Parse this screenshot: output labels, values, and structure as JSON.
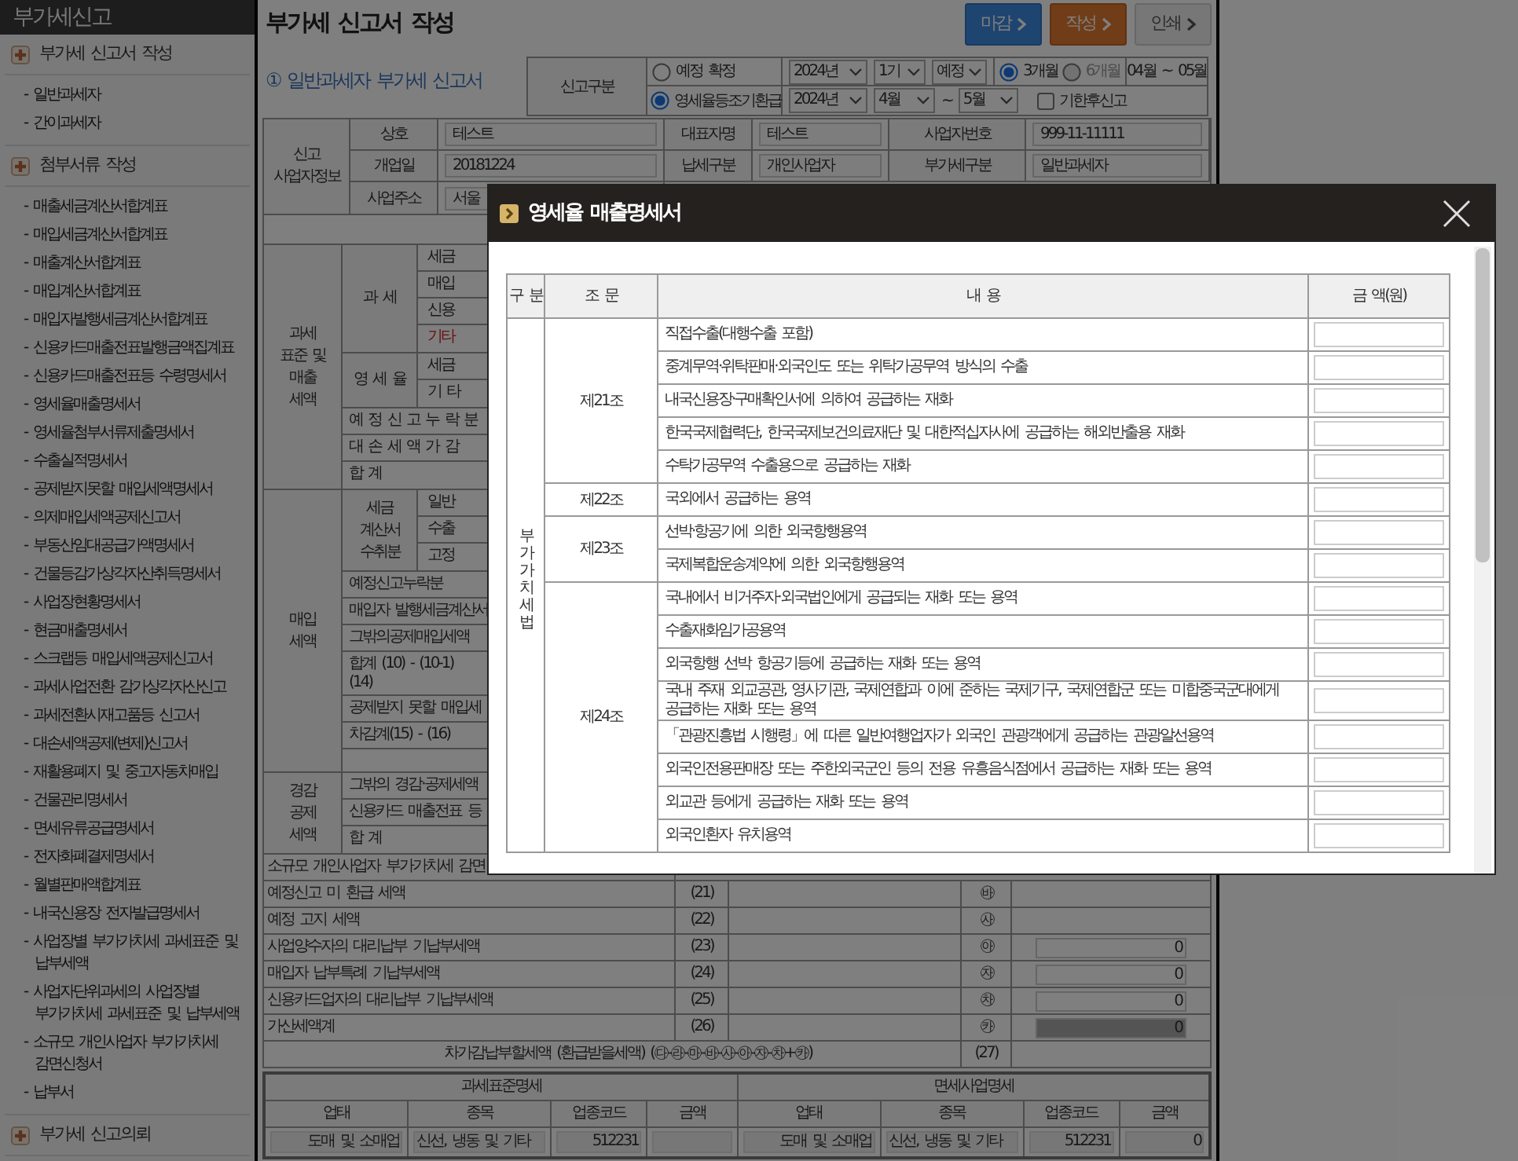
{
  "sidebar": {
    "title": "부가세신고",
    "sections": [
      {
        "label": "부가세 신고서 작성",
        "items": [
          "- 일반과세자",
          "- 간이과세자"
        ]
      },
      {
        "label": "첨부서류 작성",
        "items": [
          "- 매출세금계산서합계표",
          "- 매입세금계산서합계표",
          "- 매출계산서합계표",
          "- 매입계산서합계표",
          "- 매입자발행세금계산서합계표",
          "- 신용카드매출전표발행금액집계표",
          "- 신용카드매출전표등 수령명세서",
          "- 영세율매출명세서",
          "- 영세율첨부서류제출명세서",
          "- 수출실적명세서",
          "- 공제받지못할 매입세액명세서",
          "- 의제매입세액공제신고서",
          "- 부동산임대공급가액명세서",
          "- 건물등감가상각자산취득명세서",
          "- 사업장현황명세서",
          "- 현금매출명세서",
          "- 스크랩등 매입세액공제신고서",
          "- 과세사업전환 감가상각자산신고",
          "- 과세전환시재고품등 신고서",
          "- 대손세액공제(변제)신고서",
          "- 재활용폐지 및 중고자동차매입",
          "- 건물관리명세서",
          "- 면세유류공급명세서",
          "- 전자화폐결제명세서",
          "- 월별판매액합계표",
          "- 내국신용장 전자발급명세서",
          "- 사업장별 부가가치세 과세표준 및 납부세액",
          "- 사업자단위과세의 사업장별 부가가치세 과세표준 및 납부세액",
          "- 소규모 개인사업자 부가가치세 감면신청서",
          "- 납부서"
        ]
      },
      {
        "label": "부가세 신고의뢰"
      }
    ]
  },
  "header": {
    "title": "부가세 신고서 작성",
    "buttons": [
      {
        "label": "마감",
        "kind": "primary"
      },
      {
        "label": "작성",
        "kind": "accent"
      },
      {
        "label": "인쇄",
        "kind": "plain"
      }
    ]
  },
  "form": {
    "title": "① 일반과세자 부가세 신고서",
    "report_type": {
      "label": "신고구분",
      "type_options": [
        {
          "label": "예정 확정",
          "selected": false
        },
        {
          "label": "영세율등조기환급",
          "selected": true
        }
      ],
      "row1": {
        "selects": [
          "2024년",
          "1기",
          "예정"
        ],
        "periods": [
          {
            "label": "3개월",
            "selected": true,
            "disabled": false
          },
          {
            "label": "6개월",
            "selected": false,
            "disabled": true
          }
        ],
        "range": "04월 ~ 05월"
      },
      "row2": {
        "selects": [
          "2024년",
          "4월"
        ],
        "separator": "~",
        "end_select": "5월",
        "late_filing": {
          "label": "기한후신고",
          "checked": false
        }
      }
    },
    "business_info": {
      "label": "신고 사업자정보",
      "rows": [
        [
          {
            "label": "상호",
            "value": "테스트"
          },
          {
            "label": "대표자명",
            "value": "테스트"
          },
          {
            "label": "사업자번호",
            "value": "999-11-11111"
          }
        ],
        [
          {
            "label": "개업일",
            "value": "20181224"
          },
          {
            "label": "납세구분",
            "value": "개인사업자"
          },
          {
            "label": "부가세구분",
            "value": "일반과세자"
          }
        ],
        [
          {
            "label": "사업주소",
            "value": "서울"
          }
        ]
      ]
    },
    "blocks": [
      {
        "label": "과세 표준 및 매출 세액",
        "rows": [
          {
            "kind": "group",
            "label": "과 세",
            "items": [
              {
                "text": "세금",
                "kind": "normal"
              },
              {
                "text": "매입",
                "kind": "normal"
              },
              {
                "text": "신용",
                "kind": "normal"
              },
              {
                "text": "기타",
                "kind": "alert"
              }
            ]
          },
          {
            "kind": "group",
            "label": "영 세 율",
            "items": [
              {
                "text": "세금",
                "kind": "normal"
              },
              {
                "text": "기 타",
                "kind": "normal"
              }
            ]
          },
          {
            "kind": "line",
            "text": "예 정 신 고 누 락 분"
          },
          {
            "kind": "line",
            "text": "대 손 세 액 가 감"
          },
          {
            "kind": "line",
            "text": "합 계"
          }
        ]
      },
      {
        "label": "매입 세액",
        "rows": [
          {
            "kind": "group",
            "label": "세금 계산서 수취분",
            "items": [
              {
                "text": "일반",
                "kind": "normal"
              },
              {
                "text": "수출",
                "kind": "normal"
              },
              {
                "text": "고정",
                "kind": "normal"
              }
            ]
          },
          {
            "kind": "line",
            "text": "예정신고누락분"
          },
          {
            "kind": "line",
            "text": "매입자 발행세금계산서"
          },
          {
            "kind": "line",
            "text": "그밖의공제매입세액"
          },
          {
            "kind": "multiline",
            "lines": [
              "합계 (10) - (10-1)",
              "(14)"
            ]
          },
          {
            "kind": "line",
            "text": "공제받지 못할 매입세"
          },
          {
            "kind": "line",
            "text": "차감계(15) - (16)"
          },
          {
            "kind": "blank"
          }
        ]
      },
      {
        "label": "경감 공제 세액",
        "rows": [
          {
            "kind": "line",
            "text": "그밖의 경감·공제세액"
          },
          {
            "kind": "line",
            "text": "신용카드 매출전표 등"
          },
          {
            "kind": "line",
            "text": "합 계"
          }
        ]
      }
    ],
    "summary_rows": [
      {
        "label": "소규모 개인사업자 부가가치세 감면"
      },
      {
        "label": "예정신고 미 환급 세액",
        "number": "(21)",
        "mark": "㉳"
      },
      {
        "label": "예정 고지 세액",
        "number": "(22)",
        "mark": "㉴"
      },
      {
        "label": "사업양수자의 대리납부 기납부세액",
        "number": "(23)",
        "mark": "㉵",
        "value": "0",
        "disabled": false
      },
      {
        "label": "매입자 납부특례 기납부세액",
        "number": "(24)",
        "mark": "㉶",
        "value": "0",
        "disabled": false
      },
      {
        "label": "신용카드업자의 대리납부 기납부세액",
        "number": "(25)",
        "mark": "㉷",
        "value": "0",
        "disabled": false
      },
      {
        "label": "가산세액계",
        "number": "(26)",
        "mark": "㉸",
        "value": "0",
        "disabled": true
      }
    ],
    "totals_row": {
      "label": "차가감납부할세액 (환급받을세액) (㉰-㉱-㉲-㉳-㉴-㉵-㉶-㉷+㉸)",
      "number": "(27)"
    },
    "breakdown": [
      {
        "title": "과세표준명세",
        "columns": [
          "업태",
          "종목",
          "업종코드",
          "금액"
        ],
        "row": {
          "industry": "도매 및 소매업",
          "item": "신선, 냉동 및 기타",
          "code": "512231"
        }
      },
      {
        "title": "면세사업명세",
        "columns": [
          "업태",
          "종목",
          "업종코드",
          "금액"
        ],
        "row": {
          "industry": "도매 및 소매업",
          "item": "신선, 냉동 및 기타",
          "code": "512231",
          "amount": "0"
        }
      }
    ]
  },
  "modal": {
    "title": "영세율 매출명세서",
    "columns": [
      "구 분",
      "조 문",
      "내 용",
      "금 액(원)"
    ],
    "groups": [
      {
        "label": "부가가치세법",
        "articles": [
          {
            "label": "제21조",
            "items": [
              "직접수출(대행수출 포함)",
              "중계무역·위탁판매·외국인도 또는 위탁가공무역 방식의 수출",
              "내국신용장·구매확인서에 의하여 공급하는 재화",
              "한국국제협력단, 한국국제보건의료재단 및 대한적십자사에 공급하는 해외반출용 재화",
              "수탁가공무역 수출용으로 공급하는 재화"
            ]
          },
          {
            "label": "제22조",
            "items": [
              "국외에서 공급하는 용역"
            ]
          },
          {
            "label": "제23조",
            "items": [
              "선박·항공기에 의한 외국항행용역",
              "국제복합운송계약에 의한 외국항행용역"
            ]
          },
          {
            "label": "제24조",
            "items": [
              "국내에서 비거주자·외국법인에게 공급되는 재화 또는 용역",
              "수출재화임가공용역",
              "외국항행 선박 항공기등에 공급하는 재화 또는 용역",
              "국내 주재 외교공관, 영사기관, 국제연합과 이에 준하는 국제기구, 국제연합군 또는 미합중국군대에게 공급하는 재화 또는 용역",
              "「관광진흥법 시행령」에 따른 일반여행업자가 외국인 관광객에게 공급하는 관광알선용역",
              "외국인전용판매장 또는 주한외국군인 등의 전용 유흥음식점에서 공급하는 재화 또는 용역",
              "외교관 등에게 공급하는 재화 또는 용역",
              "외국인환자 유치용역"
            ]
          }
        ]
      }
    ]
  }
}
